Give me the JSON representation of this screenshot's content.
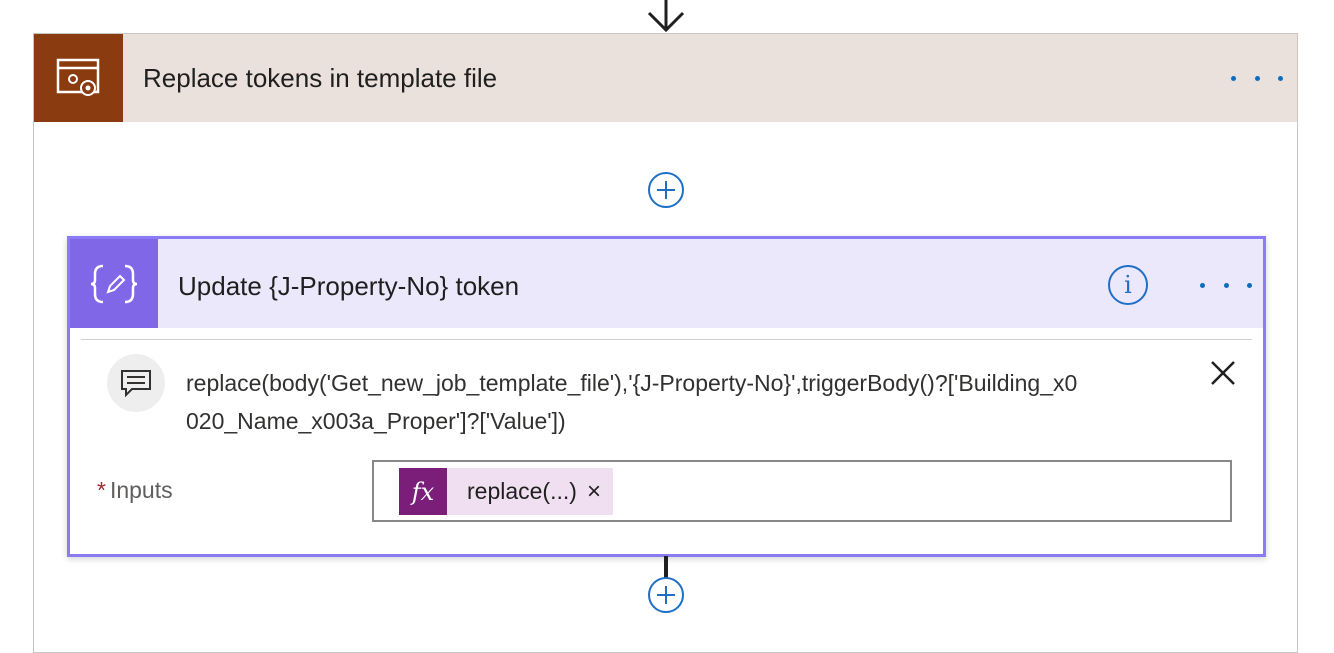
{
  "scope": {
    "title": "Replace tokens in template file",
    "icon": "settings-window-icon",
    "accent": "#8a3b0f"
  },
  "action": {
    "title": "Update {J-Property-No} token",
    "icon": "variable-edit-icon",
    "accent": "#7f67e8",
    "info_glyph": "i",
    "comment": "replace(body('Get_new_job_template_file'),'{J-Property-No}',triggerBody()?['Building_x0020_Name_x003a_Proper']?['Value'])",
    "inputs_label": "Inputs",
    "required_marker": "*",
    "token": {
      "fx_glyph": "fx",
      "label": "replace(...)",
      "remove_glyph": "×",
      "color": "#7b1e7a"
    }
  }
}
